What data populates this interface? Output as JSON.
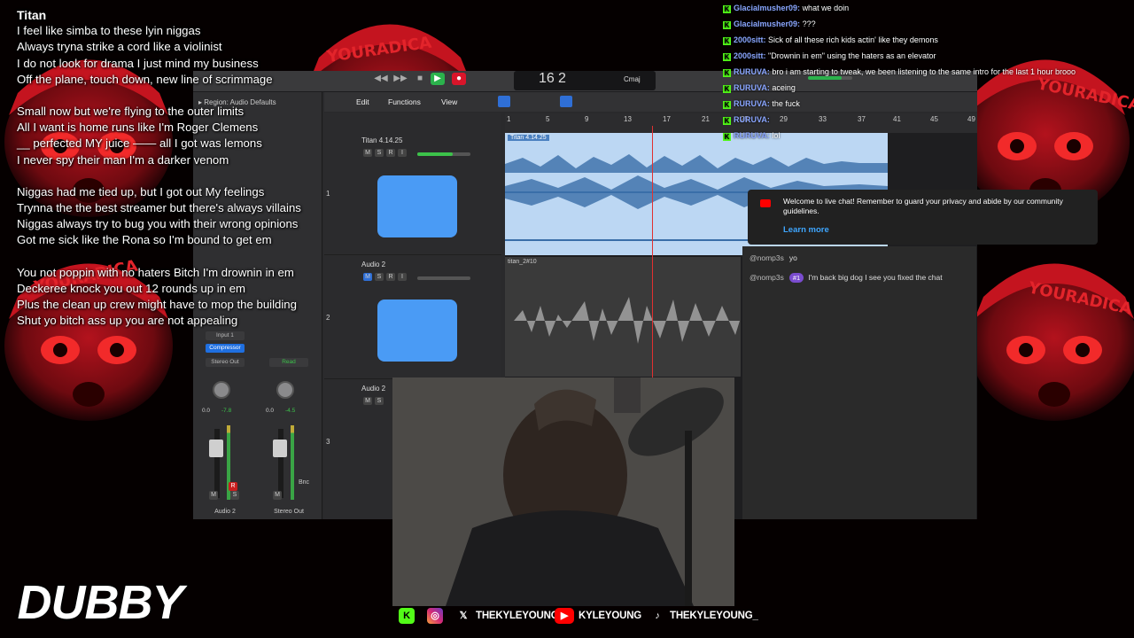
{
  "lyrics": {
    "title": "Titan",
    "stanzas": [
      [
        "I feel like simba to these lyin niggas",
        "Always tryna strike a cord like a violinist",
        "I do not look for drama I just mind my business",
        "Off the plane, touch down, new line of scrimmage"
      ],
      [
        "Small now but we're flying to the outer limits",
        "All I want is home runs like I'm Roger Clemens",
        "__ perfected MY juice —— all I got was lemons",
        "I never spy  their man I'm a darker venom"
      ],
      [
        "Niggas had me tied up, but I got out My feelings",
        "Trynna the the best streamer  but there's always villains",
        "Niggas always try to bug you with their wrong opinions",
        "Got me sick like the Rona so I'm bound to get em"
      ],
      [
        "You not poppin with no haters Bitch I'm drownin in em",
        "Deckeree knock you out 12 rounds up in em",
        "Plus the clean up crew might have to mop the building",
        "Shut yo bitch ass up you are not appealing"
      ]
    ]
  },
  "daw": {
    "lcd_bar": "16",
    "lcd_beat": "2",
    "lcd_key": "Cmaj",
    "inspector_header": "Region: Audio Defaults",
    "menus": [
      "Edit",
      "Functions",
      "View"
    ],
    "ruler": [
      "1",
      "5",
      "9",
      "13",
      "17",
      "21",
      "25",
      "29",
      "33",
      "37",
      "41",
      "45",
      "49"
    ],
    "tracks": [
      {
        "num": "1",
        "name": "Titan 4.14.25",
        "buttons": [
          "M",
          "S",
          "R",
          "I"
        ]
      },
      {
        "num": "2",
        "name": "Audio 2",
        "buttons": [
          "M",
          "S",
          "R",
          "I"
        ]
      },
      {
        "num": "3",
        "name": "Audio 2",
        "buttons": [
          "M",
          "S"
        ]
      }
    ],
    "region1_label": "Titan 4.14.25",
    "region2_label": "titan_2#10",
    "strips": [
      {
        "input": "Input 1",
        "plugin": "Compressor",
        "out": "Stereo Out",
        "val1": "0.0",
        "val2": "-7.8",
        "name": "Audio 2",
        "rec": "R",
        "buttons": [
          "M",
          "S"
        ]
      },
      {
        "input": "",
        "plugin": "",
        "out": "Read",
        "val1": "0.0",
        "val2": "-4.5",
        "name": "Stereo Out",
        "rec": "",
        "buttons": [
          "M"
        ]
      }
    ],
    "strip_bounce": "Bnc"
  },
  "chat": [
    {
      "user": "Glacialmusher09:",
      "text": "what we doin"
    },
    {
      "user": "Glacialmusher09:",
      "text": "???"
    },
    {
      "user": "2000sitt:",
      "text": "Sick of all these rich kids actin' like they demons"
    },
    {
      "user": "2000sitt:",
      "text": "\"Drownin in em\" using the haters as an elevator"
    },
    {
      "user": "RURUVA:",
      "text": "bro i am starting to tweak, we been listening to the same intro for the last 1 hour brooo"
    },
    {
      "user": "RURUVA:",
      "text": "aceing"
    },
    {
      "user": "RURUVA:",
      "text": "the fuck"
    },
    {
      "user": "RURUVA:",
      "text": ""
    },
    {
      "user": "RURUVA:",
      "text": "lol"
    }
  ],
  "yt_notice": {
    "text": "Welcome to live chat! Remember to guard your privacy and abide by our community guidelines.",
    "link": "Learn more"
  },
  "yt_chat": [
    {
      "author": "@nomp3s",
      "badge": "",
      "text": "yo"
    },
    {
      "author": "@nomp3s",
      "badge": "#1",
      "text": "I'm back big dog I see you fixed the chat"
    }
  ],
  "socials": {
    "x_handle": "THEKYLEYOUNG",
    "youtube_handle": "KYLEYOUNG",
    "tiktok_handle": "THEKYLEYOUNG_"
  },
  "logo_text": "DUBBY",
  "bg_text": "YOURADICA",
  "colors": {
    "kick_green": "#53fc18",
    "chat_user": "#8aa6ff",
    "accent_red": "#d9152a"
  }
}
